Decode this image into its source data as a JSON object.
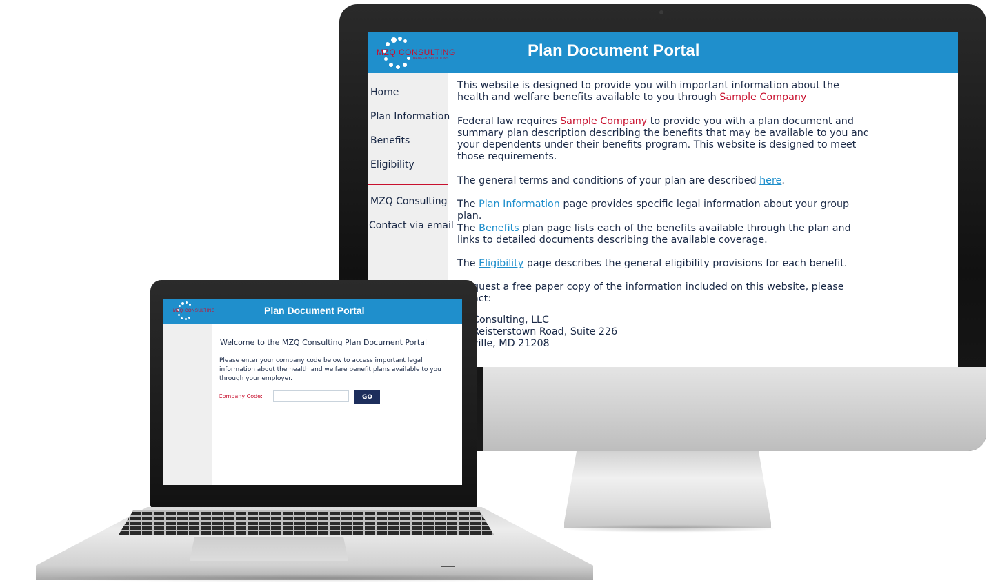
{
  "desktop": {
    "logo": {
      "text": "MZQ CONSULTING",
      "subtext": "BENEFIT SOLUTIONS"
    },
    "title": "Plan Document Portal",
    "nav": {
      "home": "Home",
      "plan_information": "Plan Information",
      "benefits": "Benefits",
      "eligibility": "Eligibility",
      "mzq_consulting": "MZQ Consulting",
      "contact": "Contact via email"
    },
    "content": {
      "p1_a": "This website is designed to provide you with important information about the health and welfare benefits available to you through ",
      "p1_company": "Sample Company",
      "p2_a": "Federal law requires ",
      "p2_company": "Sample Company",
      "p2_b": " to provide you with a plan document and summary plan description describing the benefits that may be available to you and your dependents under their benefits program. This website is designed to meet those requirements.",
      "p3_a": "The general terms and conditions of your plan are described ",
      "p3_link": "here",
      "p3_b": ".",
      "p4_a": "The ",
      "p4_link": "Plan Information",
      "p4_b": " page provides specific legal information about your group plan.",
      "p5_a": "The ",
      "p5_link": "Benefits",
      "p5_b": " plan page lists each of the benefits available through the plan and links to detailed documents describing the available coverage.",
      "p6_a": "The ",
      "p6_link": "Eligibility",
      "p6_b": " page describes the general eligibility provisions for each benefit.",
      "p7": "quest a free paper copy of the information included on this website, please act:",
      "addr1": "Consulting, LLC",
      "addr2": "Reisterstown Road, Suite 226",
      "addr3": "ville, MD 21208"
    }
  },
  "laptop": {
    "logo": {
      "text": "MZQ CONSULTING"
    },
    "title": "Plan Document Portal",
    "welcome": "Welcome to the MZQ Consulting Plan Document Portal",
    "instructions": "Please enter your company code below to access important legal information about the health and welfare benefit plans available to you through your employer.",
    "company_code_label": "Company Code:",
    "company_code_value": "",
    "go_label": "GO"
  },
  "colors": {
    "header_blue": "#1f8fcc",
    "accent_red": "#c8102e",
    "navy": "#1d2e5c",
    "link": "#1f8fcc"
  }
}
